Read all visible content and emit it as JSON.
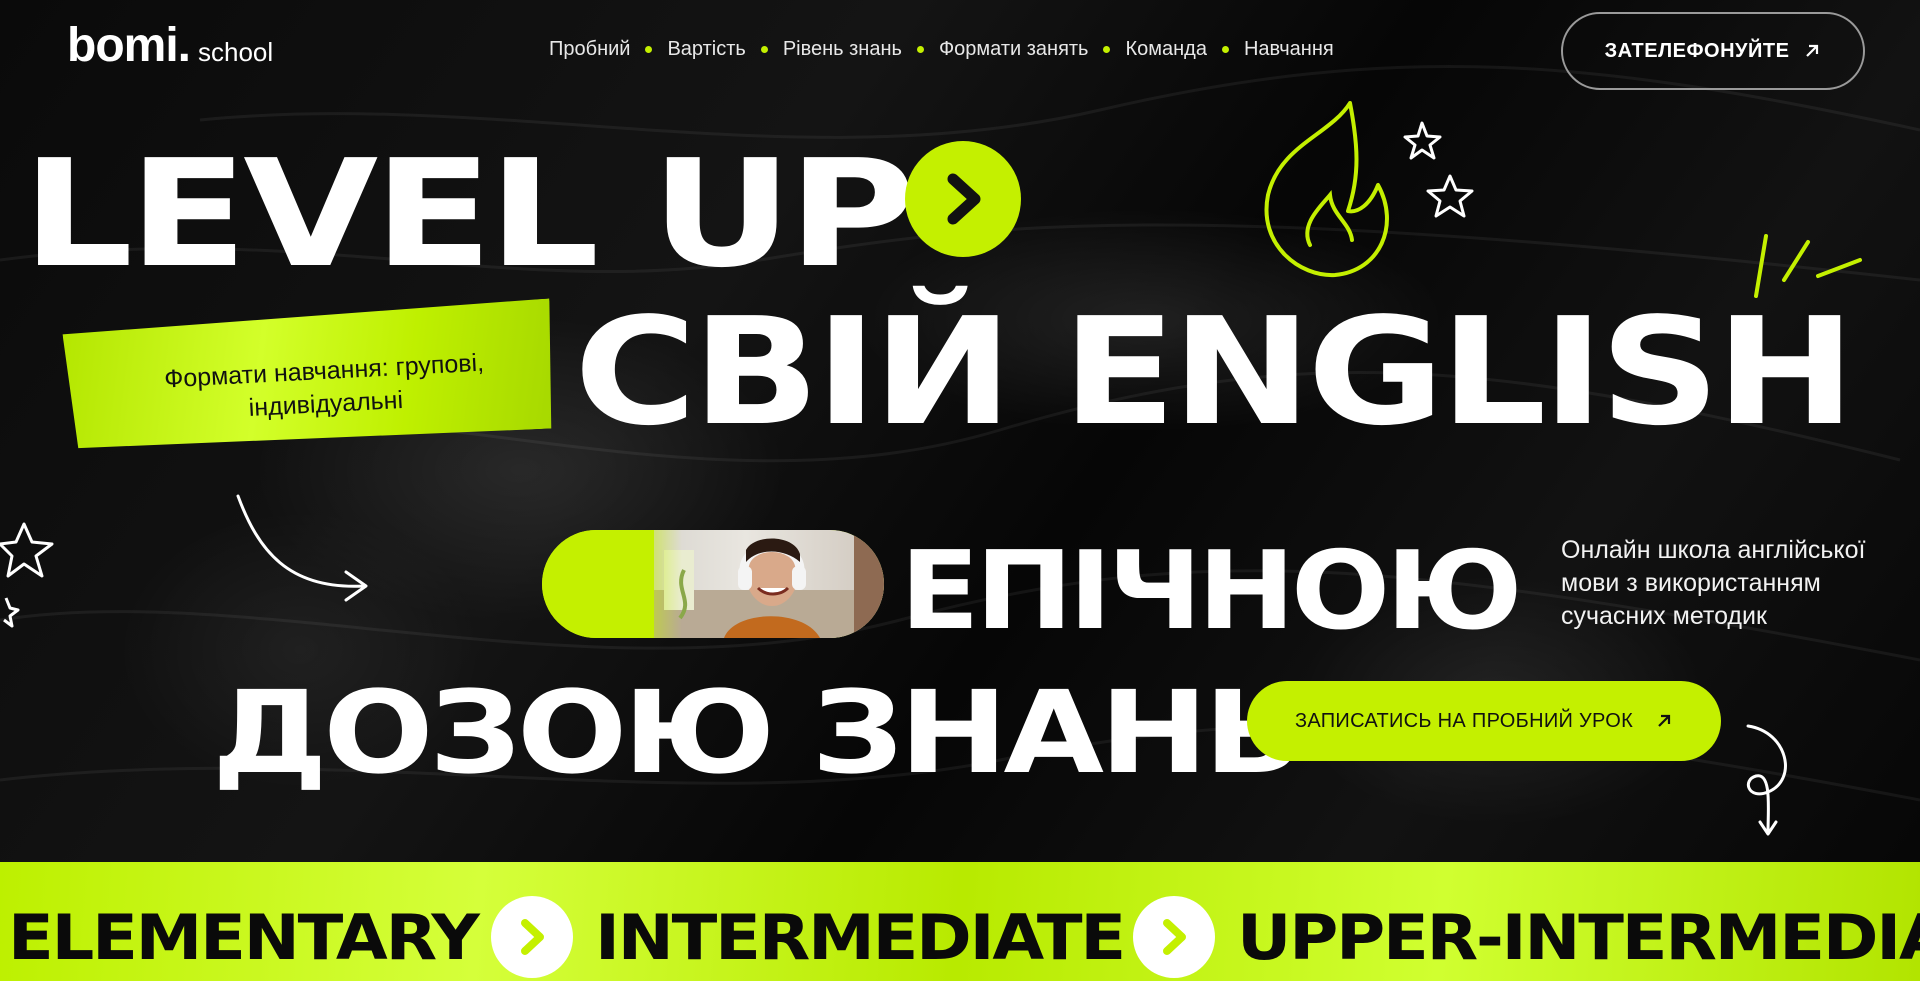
{
  "header": {
    "logo_main": "bomi.",
    "logo_sub": "school",
    "nav": [
      "Пробний",
      "Вартість",
      "Рівень знань",
      "Формати занять",
      "Команда",
      "Навчання"
    ],
    "call_button": "ЗАТЕЛЕФОНУЙТЕ"
  },
  "hero": {
    "line1": "LEVEL UP",
    "line2": "СВІЙ ENGLISH",
    "line3": "ЕПІЧНОЮ",
    "line4": "ДОЗОЮ ЗНАНЬ",
    "tape_label": "Формати навчання: групові, індивідуальні",
    "description": "Онлайн школа англійської мови з використанням сучасних методик",
    "cta": "ЗАПИСАТИСЬ НА ПРОБНИЙ УРОК"
  },
  "levels": [
    "ELEMENTARY",
    "INTERMEDIATE",
    "UPPER-INTERMEDIATE"
  ],
  "colors": {
    "accent": "#c4f000",
    "background": "#050505",
    "text": "#ffffff"
  },
  "icons": {
    "arrow": "arrow-up-right-icon",
    "chevron": "chevron-right-icon",
    "fire": "fire-doodle-icon",
    "star": "star-doodle-icon"
  }
}
